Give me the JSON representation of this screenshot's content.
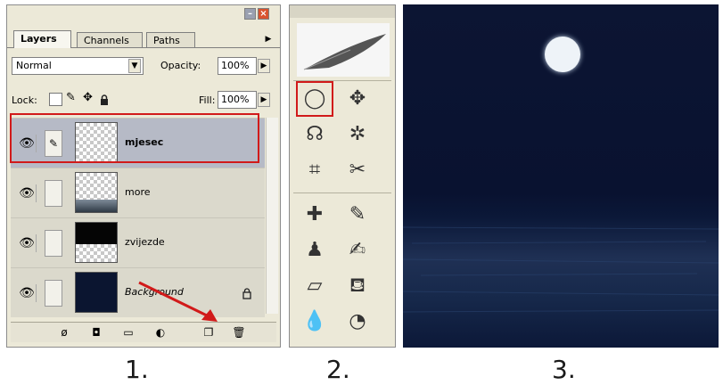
{
  "layers_panel": {
    "tabs": [
      "Layers",
      "Channels",
      "Paths"
    ],
    "blend_mode": "Normal",
    "opacity_label": "Opacity:",
    "opacity_value": "100%",
    "lock_label": "Lock:",
    "fill_label": "Fill:",
    "fill_value": "100%",
    "layers": [
      {
        "name": "mjesec",
        "selected": true
      },
      {
        "name": "more",
        "selected": false
      },
      {
        "name": "zvijezde",
        "selected": false
      },
      {
        "name": "Background",
        "selected": false,
        "locked": true
      }
    ]
  },
  "step_labels": [
    "1.",
    "2.",
    "3."
  ],
  "icons": {
    "visibility": "eye-icon",
    "link": "brush-icon",
    "lock": "lock-icon",
    "marquee": "elliptical-marquee-icon",
    "new_layer": "new-layer-icon",
    "delete": "trash-icon"
  },
  "colors": {
    "highlight": "#d11a1a",
    "selected_row": "#b6bac6",
    "panel_bg": "#ece9d8",
    "night_sky": "#0c1533",
    "moon": "#eef3f8"
  }
}
